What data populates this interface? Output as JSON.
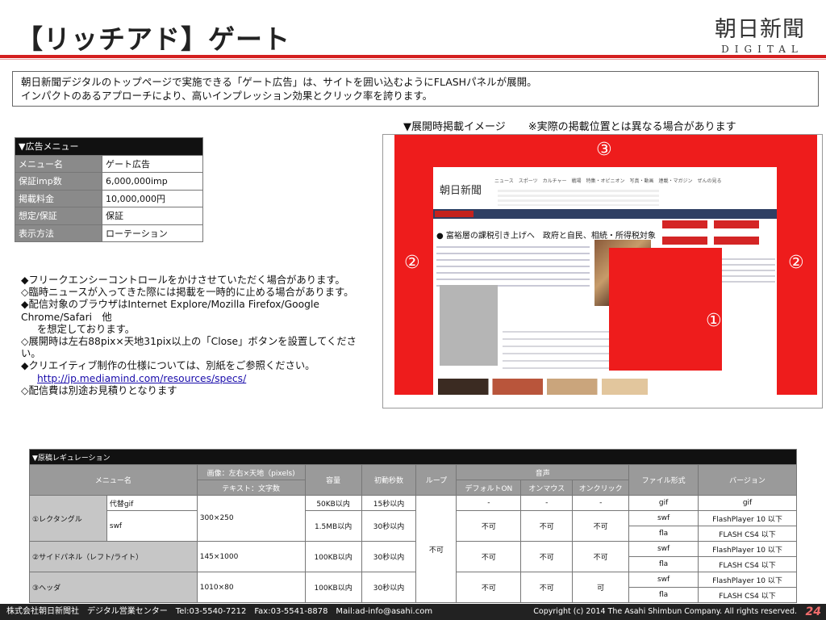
{
  "title": "【リッチアド】ゲート",
  "logo": {
    "main": "朝日新聞",
    "sub": "DIGITAL"
  },
  "intro": {
    "line1": "朝日新聞デジタルのトップページで実施できる「ゲート広告」は、サイトを囲い込むようにFLASHパネルが展開。",
    "line2": "インパクトのあるアプローチにより、高いインプレッション効果とクリック率を誇ります。"
  },
  "caption": {
    "main": "▼展開時掲載イメージ",
    "note": "※実際の掲載位置とは異なる場合があります"
  },
  "menu": {
    "header": "▼広告メニュー",
    "rows": [
      {
        "label": "メニュー名",
        "value": "ゲート広告"
      },
      {
        "label": "保証imp数",
        "value": "6,000,000imp"
      },
      {
        "label": "掲載料金",
        "value": "10,000,000円"
      },
      {
        "label": "想定/保証",
        "value": "保証"
      },
      {
        "label": "表示方法",
        "value": "ローテーション"
      }
    ]
  },
  "notes": [
    "◆フリークエンシーコントロールをかけさせていただく場合があります。",
    "◇臨時ニュースが入ってきた際には掲載を一時的に止める場合があります。",
    "◆配信対象のブラウザはInternet Explore/Mozilla Firefox/Google Chrome/Safari　他",
    "を想定しております。",
    "◇展開時は左右88pix×天地31pix以上の「Close」ボタンを設置してください。",
    "◆クリエイティブ制作の仕様については、別紙をご参照ください。",
    "http://jp.mediamind.com/resources/specs/",
    "◇配信費は別途お見積りとなります"
  ],
  "mock": {
    "label_header": "③",
    "label_side_left": "②",
    "label_side_right": "②",
    "label_rect": "①",
    "site_logo": "朝日新聞",
    "site_nav": "ニュース　スポーツ　カルチャー　戦場　特集・オピニオン　写真・動画　連載・マガジン　ぜんの見る",
    "site_headline": "● 富裕層の課税引き上げへ　政府と自民、相続・所得税対象"
  },
  "regulation": {
    "header": "▼原稿レギュレーション",
    "cols": {
      "menu": "メニュー名",
      "image": "画像：左右×天地（pixels)",
      "text": "テキスト：文字数",
      "size": "容量",
      "init_sec": "初動秒数",
      "loop": "ループ",
      "sound": "音声",
      "sound_default": "デフォルトON",
      "sound_mouse": "オンマウス",
      "sound_click": "オンクリック",
      "format": "ファイル形式",
      "version": "バージョン"
    },
    "rect": {
      "name": "①レクタングル",
      "sub_gif": "代替gif",
      "sub_swf": "swf",
      "pixels": "300×250",
      "gif_size": "50KB以内",
      "gif_sec": "15秒以内",
      "gif_d": "-",
      "gif_m": "-",
      "gif_c": "-",
      "gif_fmt": "gif",
      "gif_ver": "gif",
      "swf_size": "1.5MB以内",
      "swf_sec": "30秒以内",
      "swf_d": "不可",
      "swf_m": "不可",
      "swf_c": "不可",
      "swf_fmt": "swf",
      "swf_ver": "FlashPlayer 10 以下",
      "fla_fmt": "fla",
      "fla_ver": "FLASH CS4 以下"
    },
    "loop_value": "不可",
    "side": {
      "name": "②サイドパネル（レフト/ライト）",
      "pixels": "145×1000",
      "size": "100KB以内",
      "sec": "30秒以内",
      "d": "不可",
      "m": "不可",
      "c": "不可",
      "swf_fmt": "swf",
      "swf_ver": "FlashPlayer 10 以下",
      "fla_fmt": "fla",
      "fla_ver": "FLASH CS4 以下"
    },
    "header_ad": {
      "name": "③ヘッダ",
      "pixels": "1010×80",
      "size": "100KB以内",
      "sec": "30秒以内",
      "d": "不可",
      "m": "不可",
      "c": "可",
      "swf_fmt": "swf",
      "swf_ver": "FlashPlayer 10 以下",
      "fla_fmt": "fla",
      "fla_ver": "FLASH CS4 以下"
    }
  },
  "footer": {
    "left": "株式会社朝日新聞社　デジタル営業センター　Tel:03-5540-7212　Fax:03-5541-8878　Mail:ad-info@asahi.com",
    "right": "Copyright (c) 2014 The Asahi Shimbun Company. All rights reserved.",
    "page": "24"
  },
  "colors": {
    "accent": "#d42020",
    "ad_red": "#ee1c1c",
    "dark": "#111111",
    "label_grey": "#8a8a8a"
  }
}
